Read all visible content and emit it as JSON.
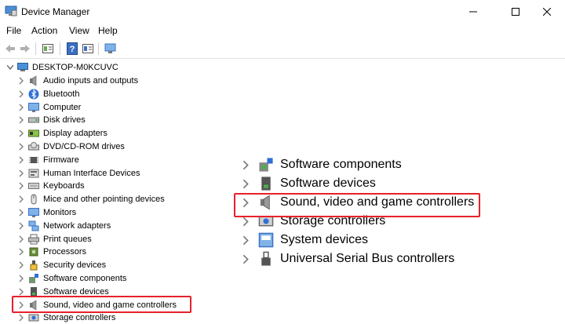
{
  "window": {
    "title": "Device Manager",
    "icons": {
      "app": "device-manager-icon",
      "minimize": "minimize-icon",
      "maximize": "maximize-icon",
      "close": "close-icon"
    }
  },
  "menu": {
    "items": [
      "File",
      "Action",
      "View",
      "Help"
    ]
  },
  "toolbar": {
    "icons": [
      "back-arrow-icon",
      "forward-arrow-icon",
      "properties-icon",
      "help-icon",
      "details-view-icon",
      "monitor-scan-icon"
    ]
  },
  "tree": {
    "root": {
      "label": "DESKTOP-M0KCUVC",
      "icon": "computer-icon"
    },
    "items": [
      {
        "label": "Audio inputs and outputs",
        "icon": "speaker-icon"
      },
      {
        "label": "Bluetooth",
        "icon": "bluetooth-icon"
      },
      {
        "label": "Computer",
        "icon": "monitor-icon"
      },
      {
        "label": "Disk drives",
        "icon": "disk-drive-icon"
      },
      {
        "label": "Display adapters",
        "icon": "display-adapter-icon"
      },
      {
        "label": "DVD/CD-ROM drives",
        "icon": "dvd-drive-icon"
      },
      {
        "label": "Firmware",
        "icon": "chip-icon"
      },
      {
        "label": "Human Interface Devices",
        "icon": "hid-icon"
      },
      {
        "label": "Keyboards",
        "icon": "keyboard-icon"
      },
      {
        "label": "Mice and other pointing devices",
        "icon": "mouse-icon"
      },
      {
        "label": "Monitors",
        "icon": "monitor-icon"
      },
      {
        "label": "Network adapters",
        "icon": "network-icon"
      },
      {
        "label": "Print queues",
        "icon": "printer-icon"
      },
      {
        "label": "Processors",
        "icon": "processor-icon"
      },
      {
        "label": "Security devices",
        "icon": "security-key-icon"
      },
      {
        "label": "Software components",
        "icon": "software-components-icon"
      },
      {
        "label": "Software devices",
        "icon": "software-device-icon"
      },
      {
        "label": "Sound, video and game controllers",
        "icon": "speaker-icon"
      },
      {
        "label": "Storage controllers",
        "icon": "storage-controller-icon"
      }
    ]
  },
  "zoom_inset": {
    "items": [
      {
        "label": "Software components",
        "icon": "software-components-icon"
      },
      {
        "label": "Software devices",
        "icon": "software-device-icon"
      },
      {
        "label": "Sound, video and game controllers",
        "icon": "speaker-icon"
      },
      {
        "label": "Storage controllers",
        "icon": "storage-controller-icon"
      },
      {
        "label": "System devices",
        "icon": "system-device-icon"
      },
      {
        "label": "Universal Serial Bus controllers",
        "icon": "usb-icon"
      }
    ]
  },
  "colors": {
    "highlight_border": "#e8202a",
    "chevron": "#7a7a7a",
    "icon_blue": "#2f6fd6"
  }
}
